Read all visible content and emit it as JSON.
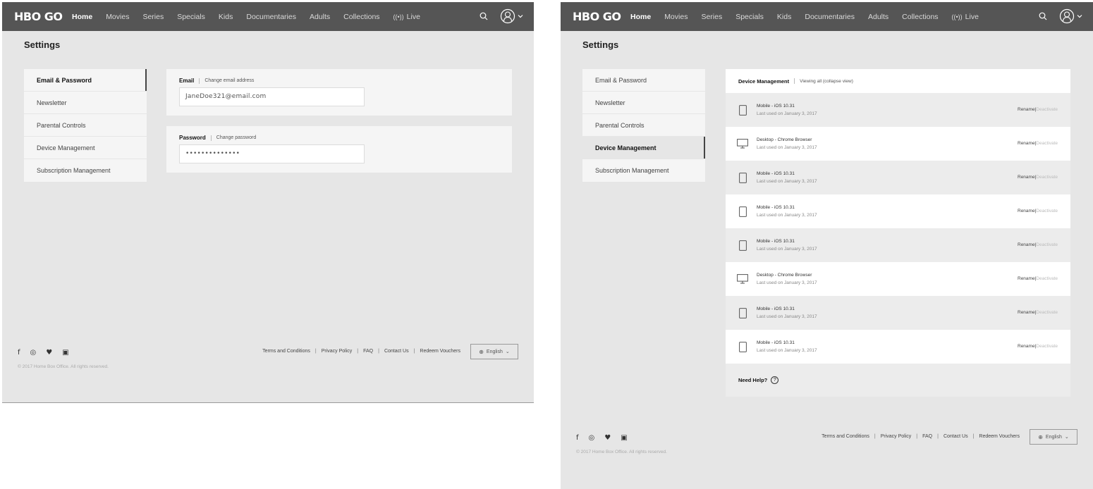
{
  "nav": {
    "logo": "HBO GO",
    "items": [
      "Home",
      "Movies",
      "Series",
      "Specials",
      "Kids",
      "Documentaries",
      "Adults",
      "Collections"
    ],
    "live_label": "Live"
  },
  "page_title": "Settings",
  "menu": [
    "Email & Password",
    "Newsletter",
    "Parental Controls",
    "Device Management",
    "Subscription Management"
  ],
  "email_section": {
    "label": "Email",
    "link": "Change email address",
    "value": "JaneDoe321@email.com"
  },
  "password_section": {
    "label": "Password",
    "link": "Change password",
    "value": "••••••••••••••"
  },
  "device_management": {
    "title": "Device Management",
    "view_link": "Viewing all (collapse view)",
    "rename_label": "Rename",
    "separator": "|",
    "deactivate_label": "Deactivate",
    "devices": [
      {
        "type": "mobile",
        "name": "Mobile - iOS 10.31",
        "last_used": "Last used on January 3, 2017"
      },
      {
        "type": "desktop",
        "name": "Desktop - Chrome Browser",
        "last_used": "Last used on January 3, 2017"
      },
      {
        "type": "mobile",
        "name": "Mobile - iOS 10.31",
        "last_used": "Last used on January 3, 2017"
      },
      {
        "type": "mobile",
        "name": "Mobile - iOS 10.31",
        "last_used": "Last used on January 3, 2017"
      },
      {
        "type": "mobile",
        "name": "Mobile - iOS 10.31",
        "last_used": "Last used on January 3, 2017"
      },
      {
        "type": "desktop",
        "name": "Desktop - Chrome Browser",
        "last_used": "Last used on January 3, 2017"
      },
      {
        "type": "mobile",
        "name": "Mobile - iOS 10.31",
        "last_used": "Last used on January 3, 2017"
      },
      {
        "type": "mobile",
        "name": "Mobile - iOS 10.31",
        "last_used": "Last used on January 3, 2017"
      }
    ],
    "help_label": "Need Help?",
    "help_icon_glyph": "?"
  },
  "footer": {
    "links": [
      "Terms and Conditions",
      "Privacy Policy",
      "FAQ",
      "Contact Us",
      "Redeem Vouchers"
    ],
    "link_separator": "|",
    "language": "English",
    "copyright": "© 2017 Home Box Office. All rights reserved.",
    "social": [
      "facebook-icon",
      "instagram-icon",
      "twitter-icon",
      "youtube-icon"
    ]
  },
  "colors": {
    "nav_bg": "#555555",
    "page_bg": "#e6e6e6",
    "panel_bg": "#f5f5f5",
    "deactivate_text": "#bbbbbb"
  }
}
